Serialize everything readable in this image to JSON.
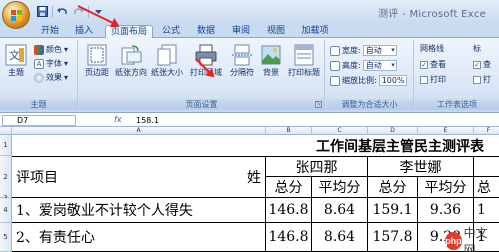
{
  "window": {
    "title": "测评 - Microsoft Exce"
  },
  "qat": {
    "icons": [
      "save-icon",
      "undo-icon",
      "redo-icon",
      "qat-dropdown-icon"
    ]
  },
  "tabs": [
    {
      "label": "开始",
      "active": false
    },
    {
      "label": "插入",
      "active": false
    },
    {
      "label": "页面布局",
      "active": true
    },
    {
      "label": "公式",
      "active": false
    },
    {
      "label": "数据",
      "active": false
    },
    {
      "label": "审阅",
      "active": false
    },
    {
      "label": "视图",
      "active": false
    },
    {
      "label": "加载项",
      "active": false
    }
  ],
  "ribbon": {
    "theme_group": {
      "label": "主题",
      "theme_button": "主题",
      "colors": "颜色",
      "fonts": "字体",
      "effects": "效果"
    },
    "page_setup_group": {
      "label": "页面设置",
      "buttons": [
        "页边距",
        "纸张方向",
        "纸张大小",
        "打印区域",
        "分隔符",
        "背景",
        "打印标题"
      ]
    },
    "scale_group": {
      "label": "调整为合适大小",
      "width_label": "宽度:",
      "width_value": "自动",
      "height_label": "高度:",
      "height_value": "自动",
      "scale_label": "缩放比例:",
      "scale_value": "100%"
    },
    "sheet_options_group": {
      "label": "工作表选项",
      "gridlines_title": "网格线",
      "gridlines_view": "查看",
      "gridlines_print": "打印",
      "headings_title": "标",
      "headings_view": "查",
      "headings_print": "打"
    }
  },
  "formula_bar": {
    "name_box": "D7",
    "fx": "fx",
    "value": "158.1"
  },
  "sheet": {
    "column_letters": [
      "A",
      "B",
      "C",
      "D",
      "E",
      "F"
    ],
    "row_numbers": [
      "1",
      "2",
      "3",
      "4",
      "5"
    ],
    "title": "工作间基层主管民主测评表",
    "eval_item_header": "评项目",
    "name_header": "姓",
    "people": [
      "张四那",
      "李世娜"
    ],
    "sub_headers": [
      "总分",
      "平均分",
      "总分",
      "平均分",
      "总"
    ],
    "rows": [
      {
        "item": "1、爱岗敬业不计较个人得失",
        "values": [
          "146.8",
          "8.64",
          "159.1",
          "9.36",
          "1"
        ]
      },
      {
        "item": "2、有责任心",
        "values": [
          "146.8",
          "8.64",
          "157.8",
          "9.28",
          "1"
        ]
      }
    ]
  },
  "watermark": {
    "icon_text": "php",
    "text": "中文网"
  }
}
